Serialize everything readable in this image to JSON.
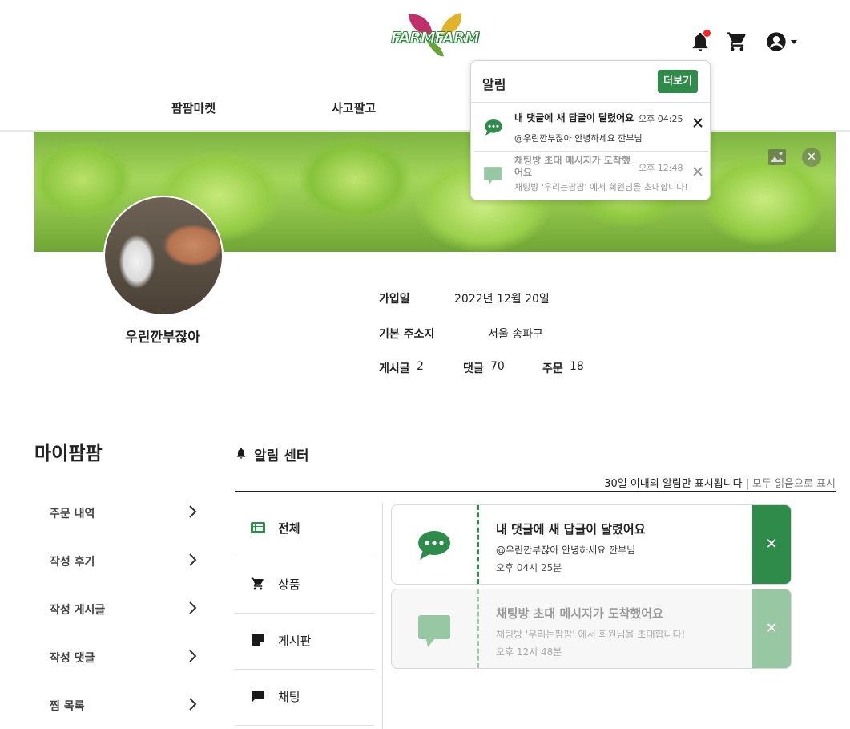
{
  "header": {
    "logo_text": "FARMFARM",
    "nav": [
      "팜팜마켓",
      "사고팔고"
    ],
    "icons": [
      "bell-icon",
      "cart-icon",
      "user-icon",
      "caret-down-icon"
    ],
    "bell_has_unread": true
  },
  "banner": {
    "actions": [
      "image-icon",
      "close-icon"
    ]
  },
  "profile": {
    "nickname": "우린깐부잖아",
    "join_label": "가입일",
    "join_value": "2022년 12월 20일",
    "address_label": "기본 주소지",
    "address_value": "서울 송파구",
    "posts_label": "게시글",
    "posts_value": "2",
    "comments_label": "댓글",
    "comments_value": "70",
    "orders_label": "주문",
    "orders_value": "18"
  },
  "sidebar": {
    "title": "마이팜팜",
    "items": [
      {
        "label": "주문 내역"
      },
      {
        "label": "작성 후기"
      },
      {
        "label": "작성 게시글"
      },
      {
        "label": "작성 댓글"
      },
      {
        "label": "찜 목록"
      }
    ]
  },
  "notice_center": {
    "title": "알림 센터",
    "info_text": "30일 이내의 알림만 표시됩니다",
    "separator": "|",
    "mark_all_read": "모두 읽음으로 표시",
    "categories": [
      {
        "label": "전체",
        "icon": "list-icon",
        "active": true
      },
      {
        "label": "상품",
        "icon": "cart-icon",
        "active": false
      },
      {
        "label": "게시판",
        "icon": "note-icon",
        "active": false
      },
      {
        "label": "채팅",
        "icon": "chat-icon",
        "active": false
      }
    ],
    "notifications": [
      {
        "title": "내 댓글에 새 답글이 달렸어요",
        "body": "@우린깐부잖아 안녕하세요 깐부님",
        "time": "오후 04시 25분",
        "read": false,
        "icon": "comment-bubble-icon"
      },
      {
        "title": "채팅방 초대 메시지가 도착했어요",
        "body": "채팅방 '우리는팜팜' 에서 회원님을 초대합니다!",
        "time": "오후 12시 48분",
        "read": true,
        "icon": "chat-square-icon"
      }
    ]
  },
  "popup": {
    "title": "알림",
    "more_label": "더보기",
    "items": [
      {
        "title": "내 댓글에 새 답글이 달렸어요",
        "time": "오후 04:25",
        "body": "@우린깐부잖아 안녕하세요 깐부님",
        "read": false
      },
      {
        "title": "채팅방 초대 메시지가 도착했어요",
        "time": "오후 12:48",
        "body": "채팅방 '우리는팜팜' 에서 회원님을 초대합니다!",
        "read": true
      }
    ]
  },
  "colors": {
    "accent": "#2e8b4a",
    "accent_light": "#98c8a3",
    "badge": "#ff1f1f"
  }
}
